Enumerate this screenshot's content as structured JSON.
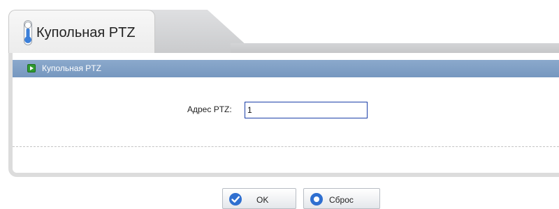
{
  "tab": {
    "title": "Купольная PTZ",
    "indicator_icon": "toggle-indicator-icon",
    "accent": "#3b7fd9"
  },
  "section": {
    "title": "Купольная PTZ",
    "header_color": "#7f9fc6",
    "icon": "green-arrow-icon"
  },
  "form": {
    "ptz_address_label": "Адрес PTZ:",
    "ptz_address_value": "1"
  },
  "buttons": {
    "ok_label": "OK",
    "ok_icon": "check-circle-icon",
    "reset_label": "Сброс",
    "reset_icon": "circle-icon"
  }
}
